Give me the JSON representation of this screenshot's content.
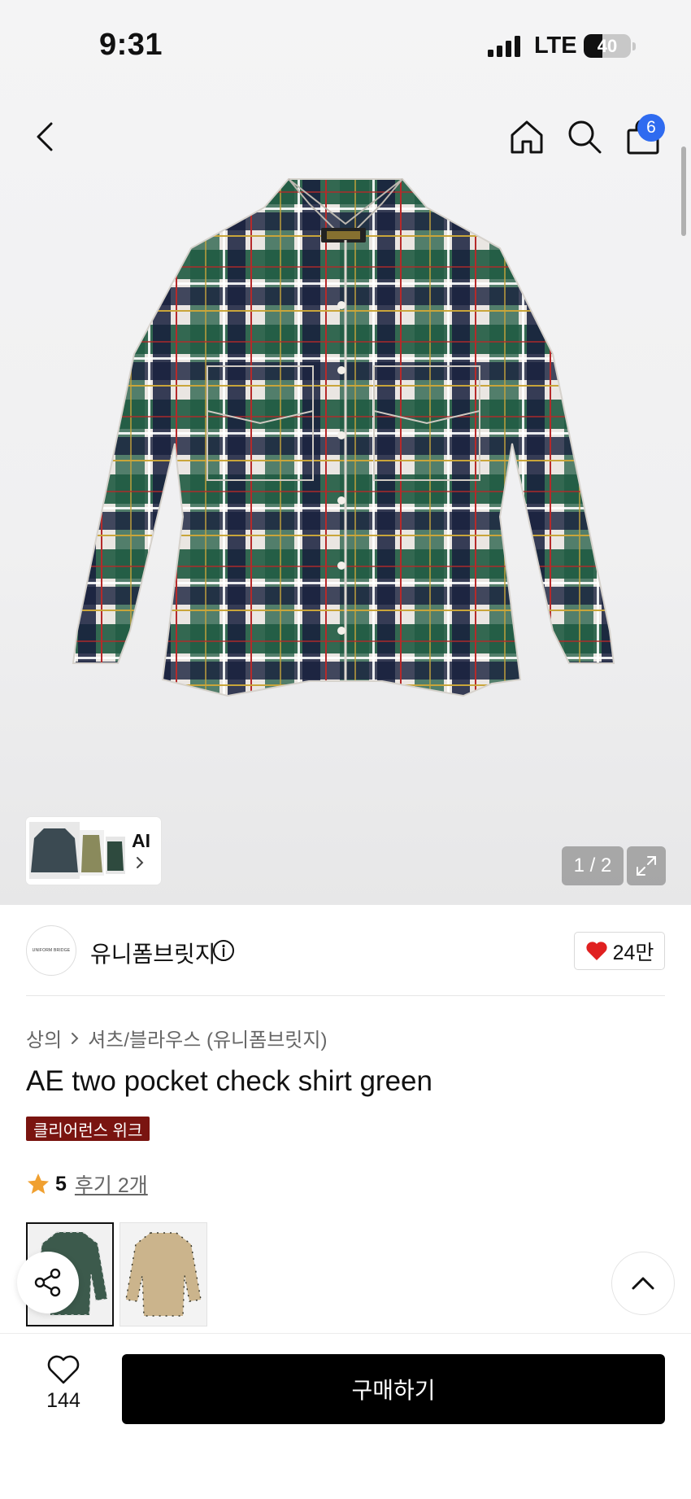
{
  "status_bar": {
    "time": "9:31",
    "network": "LTE",
    "battery": "40",
    "battery_level": 0.4
  },
  "top_nav": {
    "back_icon": "chevron-left-icon",
    "home_icon": "home-icon",
    "search_icon": "search-icon",
    "cart_icon": "shopping-bag-icon",
    "cart_count": "6"
  },
  "gallery": {
    "pager": "1 / 2",
    "ai_label": "AI",
    "fullscreen_icon": "expand-icon"
  },
  "brand": {
    "name": "유니폼브릿지",
    "logo_text": "UNIFORM BRIDGE",
    "like_count": "24만"
  },
  "product": {
    "breadcrumb": [
      "상의",
      "셔츠/블라우스 (유니폼브릿지)"
    ],
    "title": "AE two pocket check shirt green",
    "promo_badge": "클리어런스 위크",
    "rating": "5",
    "review_link": "후기 2개"
  },
  "colors": {
    "accent_badge": "#7a1410",
    "cart_badge": "#2f6bf0",
    "heart": "#e02020"
  },
  "bottom_bar": {
    "wish_count": "144",
    "buy_label": "구매하기"
  }
}
